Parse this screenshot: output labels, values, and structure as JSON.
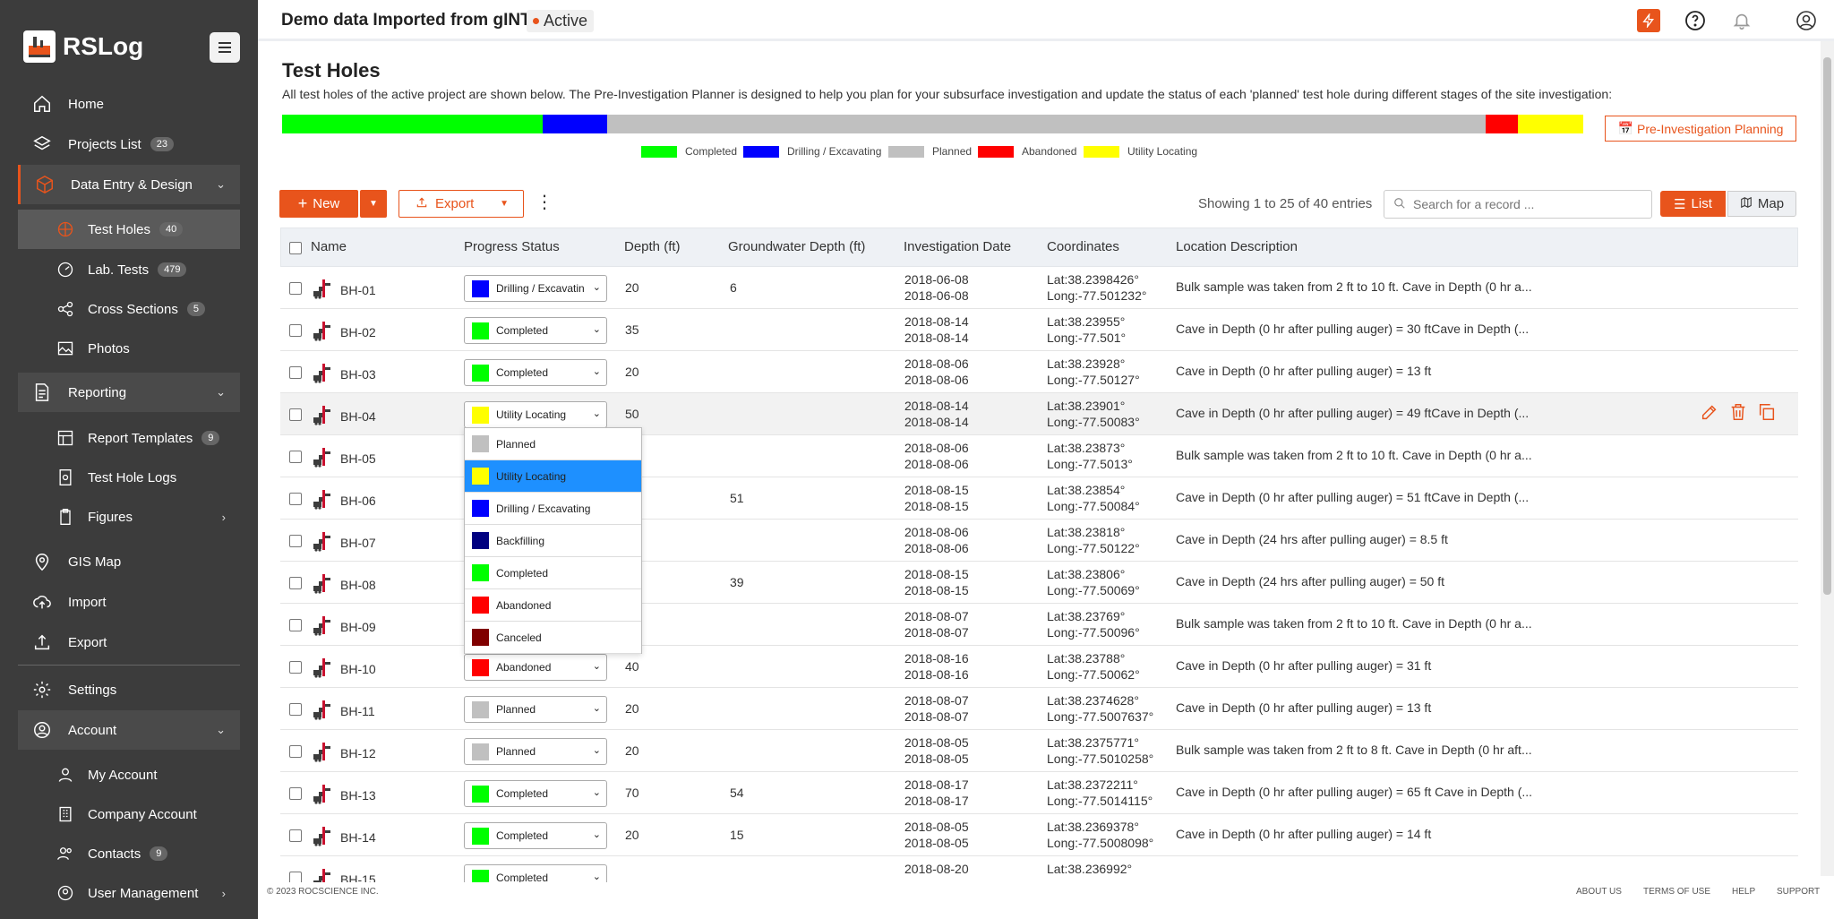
{
  "app": {
    "name": "RSLog"
  },
  "sidebar": {
    "items": [
      {
        "label": "Home"
      },
      {
        "label": "Projects List",
        "badge": "23"
      },
      {
        "label": "Data Entry & Design"
      },
      {
        "label": "Test Holes",
        "badge": "40"
      },
      {
        "label": "Lab. Tests",
        "badge": "479"
      },
      {
        "label": "Cross Sections",
        "badge": "5"
      },
      {
        "label": "Photos"
      },
      {
        "label": "Reporting"
      },
      {
        "label": "Report Templates",
        "badge": "9"
      },
      {
        "label": "Test Hole Logs"
      },
      {
        "label": "Figures"
      },
      {
        "label": "GIS Map"
      },
      {
        "label": "Import"
      },
      {
        "label": "Export"
      },
      {
        "label": "Settings"
      },
      {
        "label": "Account"
      },
      {
        "label": "My Account"
      },
      {
        "label": "Company Account"
      },
      {
        "label": "Contacts",
        "badge": "9"
      },
      {
        "label": "User Management"
      }
    ]
  },
  "header": {
    "project_title": "Demo data Imported from gINT",
    "status": "Active"
  },
  "main": {
    "title": "Test Holes",
    "description": "All test holes of the active project are shown below. The Pre-Investigation Planner is designed to help you plan for your subsurface investigation and update the status of each 'planned' test hole during different stages of the site investigation:",
    "pre_investigation_button": "Pre-Investigation Planning",
    "progress": [
      {
        "status": "Completed",
        "fraction": 0.2,
        "color": "#00ff00"
      },
      {
        "status": "Drilling / Excavating",
        "fraction": 0.05,
        "color": "#0000ff"
      },
      {
        "status": "Planned",
        "fraction": 0.675,
        "color": "#c0c0c0"
      },
      {
        "status": "Abandoned",
        "fraction": 0.025,
        "color": "#ff0000"
      },
      {
        "status": "Utility Locating",
        "fraction": 0.05,
        "color": "#ffff00"
      }
    ],
    "legend": [
      {
        "label": "Completed",
        "color": "#00ff00"
      },
      {
        "label": "Drilling / Excavating",
        "color": "#0000ff"
      },
      {
        "label": "Planned",
        "color": "#c0c0c0"
      },
      {
        "label": "Abandoned",
        "color": "#ff0000"
      },
      {
        "label": "Utility Locating",
        "color": "#ffff00"
      }
    ],
    "toolbar": {
      "new_label": "New",
      "export_label": "Export",
      "showing": "Showing 1 to 25 of 40 entries",
      "search_placeholder": "Search for a record ...",
      "list_label": "List",
      "map_label": "Map"
    },
    "columns": [
      "Name",
      "Progress Status",
      "Depth (ft)",
      "Groundwater Depth (ft)",
      "Investigation Date",
      "Coordinates",
      "Location Description"
    ],
    "rows": [
      {
        "name": "BH-01",
        "status": "Drilling / Excavatin",
        "status_color": "#0000ff",
        "depth": "20",
        "gw": "6",
        "date1": "2018-06-08",
        "date2": "2018-06-08",
        "lat": "Lat:38.2398426°",
        "long": "Long:-77.501232°",
        "desc": "Bulk sample was taken from 2 ft to 10 ft. Cave in Depth (0 hr a..."
      },
      {
        "name": "BH-02",
        "status": "Completed",
        "status_color": "#00ff00",
        "depth": "35",
        "gw": "",
        "date1": "2018-08-14",
        "date2": "2018-08-14",
        "lat": "Lat:38.23955°",
        "long": "Long:-77.501°",
        "desc": "Cave in Depth (0 hr after pulling auger) = 30 ftCave in Depth (..."
      },
      {
        "name": "BH-03",
        "status": "Completed",
        "status_color": "#00ff00",
        "depth": "20",
        "gw": "",
        "date1": "2018-08-06",
        "date2": "2018-08-06",
        "lat": "Lat:38.23928°",
        "long": "Long:-77.50127°",
        "desc": "Cave in Depth (0 hr after pulling auger) = 13 ft"
      },
      {
        "name": "BH-04",
        "status": "Utility Locating",
        "status_color": "#ffff00",
        "depth": "50",
        "gw": "",
        "date1": "2018-08-14",
        "date2": "2018-08-14",
        "lat": "Lat:38.23901°",
        "long": "Long:-77.50083°",
        "desc": "Cave in Depth (0 hr after pulling auger) = 49 ftCave in Depth (..."
      },
      {
        "name": "BH-05",
        "status": "",
        "status_color": "",
        "depth": "",
        "gw": "",
        "date1": "2018-08-06",
        "date2": "2018-08-06",
        "lat": "Lat:38.23873°",
        "long": "Long:-77.5013°",
        "desc": "Bulk sample was taken from 2 ft to 10 ft. Cave in Depth (0 hr a..."
      },
      {
        "name": "BH-06",
        "status": "",
        "status_color": "",
        "depth": "",
        "gw": "51",
        "date1": "2018-08-15",
        "date2": "2018-08-15",
        "lat": "Lat:38.23854°",
        "long": "Long:-77.50084°",
        "desc": "Cave in Depth (0 hr after pulling auger) = 51 ftCave in Depth (..."
      },
      {
        "name": "BH-07",
        "status": "",
        "status_color": "",
        "depth": "",
        "gw": "",
        "date1": "2018-08-06",
        "date2": "2018-08-06",
        "lat": "Lat:38.23818°",
        "long": "Long:-77.50122°",
        "desc": "Cave in Depth (24 hrs after pulling auger) = 8.5 ft"
      },
      {
        "name": "BH-08",
        "status": "",
        "status_color": "",
        "depth": "",
        "gw": "39",
        "date1": "2018-08-15",
        "date2": "2018-08-15",
        "lat": "Lat:38.23806°",
        "long": "Long:-77.50069°",
        "desc": "Cave in Depth (24 hrs after pulling auger) = 50 ft"
      },
      {
        "name": "BH-09",
        "status": "",
        "status_color": "",
        "depth": "",
        "gw": "",
        "date1": "2018-08-07",
        "date2": "2018-08-07",
        "lat": "Lat:38.23769°",
        "long": "Long:-77.50096°",
        "desc": "Bulk sample was taken from 2 ft to 10 ft. Cave in Depth (0 hr a..."
      },
      {
        "name": "BH-10",
        "status": "Abandoned",
        "status_color": "#ff0000",
        "depth": "40",
        "gw": "",
        "date1": "2018-08-16",
        "date2": "2018-08-16",
        "lat": "Lat:38.23788°",
        "long": "Long:-77.50062°",
        "desc": "Cave in Depth (0 hr after pulling auger) = 31 ft"
      },
      {
        "name": "BH-11",
        "status": "Planned",
        "status_color": "#c0c0c0",
        "depth": "20",
        "gw": "",
        "date1": "2018-08-07",
        "date2": "2018-08-07",
        "lat": "Lat:38.2374628°",
        "long": "Long:-77.5007637°",
        "desc": "Cave in Depth (0 hr after pulling auger) = 13 ft"
      },
      {
        "name": "BH-12",
        "status": "Planned",
        "status_color": "#c0c0c0",
        "depth": "20",
        "gw": "",
        "date1": "2018-08-05",
        "date2": "2018-08-05",
        "lat": "Lat:38.2375771°",
        "long": "Long:-77.5010258°",
        "desc": "Bulk sample was taken from 2 ft to 8 ft. Cave in Depth (0 hr aft..."
      },
      {
        "name": "BH-13",
        "status": "Completed",
        "status_color": "#00ff00",
        "depth": "70",
        "gw": "54",
        "date1": "2018-08-17",
        "date2": "2018-08-17",
        "lat": "Lat:38.2372211°",
        "long": "Long:-77.5014115°",
        "desc": "Cave in Depth (0 hr after pulling auger) = 65 ft Cave in Depth (..."
      },
      {
        "name": "BH-14",
        "status": "Completed",
        "status_color": "#00ff00",
        "depth": "20",
        "gw": "15",
        "date1": "2018-08-05",
        "date2": "2018-08-05",
        "lat": "Lat:38.2369378°",
        "long": "Long:-77.5008098°",
        "desc": "Cave in Depth (0 hr after pulling auger) = 14 ft"
      },
      {
        "name": "BH-15",
        "status": "Completed",
        "status_color": "#00ff00",
        "depth": "",
        "gw": "",
        "date1": "2018-08-20",
        "date2": "",
        "lat": "Lat:38.236992°",
        "long": "",
        "desc": ""
      }
    ],
    "dropdown_options": [
      {
        "label": "Planned",
        "color": "#c0c0c0"
      },
      {
        "label": "Utility Locating",
        "color": "#ffff00"
      },
      {
        "label": "Drilling / Excavating",
        "color": "#0000ff"
      },
      {
        "label": "Backfilling",
        "color": "#000080"
      },
      {
        "label": "Completed",
        "color": "#00ff00"
      },
      {
        "label": "Abandoned",
        "color": "#ff0000"
      },
      {
        "label": "Canceled",
        "color": "#800000"
      }
    ]
  },
  "footer": {
    "copyright": "© 2023 ROCSCIENCE INC.",
    "links": [
      "ABOUT US",
      "TERMS OF USE",
      "HELP",
      "SUPPORT"
    ]
  },
  "colors": {
    "accent": "#e8541c",
    "sidebar_bg": "#3c3c3c"
  }
}
